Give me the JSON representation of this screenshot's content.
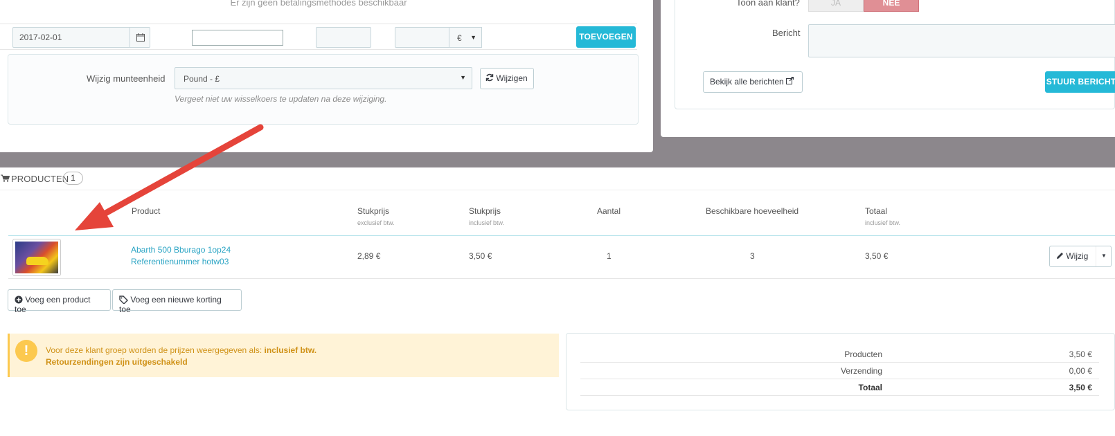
{
  "payment": {
    "no_methods": "Er zijn geen betalingsmethodes beschikbaar",
    "date_value": "2017-02-01",
    "currency_symbol": "€",
    "add_button": "TOEVOEGEN"
  },
  "currency": {
    "label": "Wijzig munteenheid",
    "selected": "Pound - £",
    "change_button": "Wijzigen",
    "hint": "Vergeet niet uw wisselkoers te updaten na deze wijziging."
  },
  "messages": {
    "show_label": "Toon aan klant?",
    "toggle_yes": "JA",
    "toggle_no": "NEE",
    "message_label": "Bericht",
    "view_all_button": "Bekijk alle berichten",
    "send_button": "STUUR BERICHT"
  },
  "products": {
    "title": "PRODUCTEN",
    "count": "1",
    "columns": {
      "product": "Product",
      "unit_price_ex": "Stukprijs",
      "unit_price_ex_sub": "exclusief btw.",
      "unit_price_in": "Stukprijs",
      "unit_price_in_sub": "inclusief btw.",
      "qty": "Aantal",
      "available": "Beschikbare hoeveelheid",
      "total": "Totaal",
      "total_sub": "inclusief btw."
    },
    "rows": [
      {
        "name": "Abarth 500 Bburago 1op24",
        "reference": "Referentienummer hotw03",
        "unit_ex": "2,89 €",
        "unit_in": "3,50 €",
        "qty": "1",
        "available": "3",
        "total": "3,50 €",
        "edit_button": "Wijzig"
      }
    ],
    "add_product_button": "Voeg een product toe",
    "add_discount_button": "Voeg een nieuwe korting toe"
  },
  "alert": {
    "icon": "!",
    "line1_prefix": "Voor deze klant groep worden de prijzen weergegeven als:",
    "line1_bold": "inclusief btw.",
    "line2": "Retourzendingen zijn uitgeschakeld"
  },
  "totals": [
    {
      "label": "Producten",
      "value": "3,50 €"
    },
    {
      "label": "Verzending",
      "value": "0,00 €"
    },
    {
      "label": "Totaal",
      "value": "3,50 €"
    }
  ],
  "colors": {
    "accent": "#25b9d7",
    "link": "#2aa4c4",
    "toggle_no": "#e08f95",
    "alert_bg": "#fff3d7",
    "alert_text": "#d09218",
    "annotation_arrow": "#e5443a"
  }
}
